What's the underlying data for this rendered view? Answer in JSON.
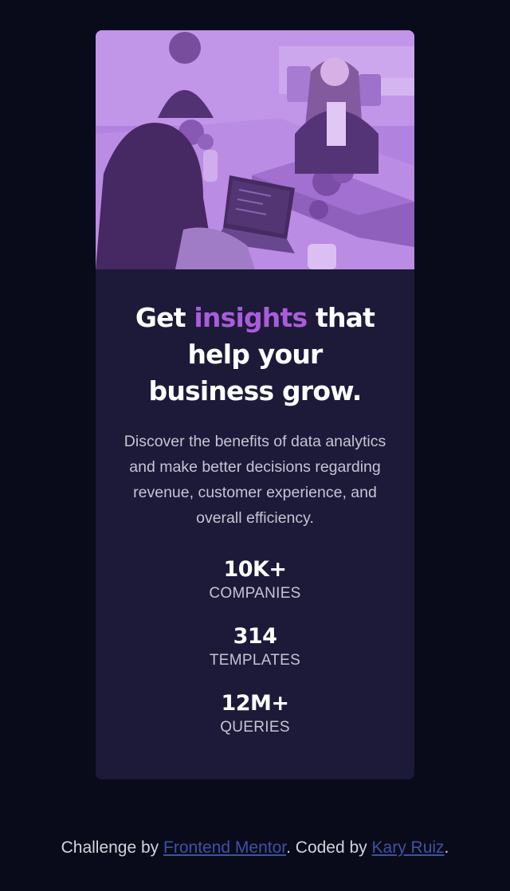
{
  "card": {
    "image": {
      "subject": "team of people working at laptops in office",
      "tint_color": "#aa5cdb"
    },
    "headline": {
      "before": "Get ",
      "accent": "insights",
      "after": " that help your business grow."
    },
    "description": "Discover the benefits of data analytics and make better decisions regarding revenue, customer experience, and overall efficiency.",
    "stats": [
      {
        "value": "10K+",
        "label": "COMPANIES"
      },
      {
        "value": "314",
        "label": "TEMPLATES"
      },
      {
        "value": "12M+",
        "label": "QUERIES"
      }
    ]
  },
  "attribution": {
    "prefix": "Challenge by ",
    "link1": "Frontend Mentor",
    "middle": ". Coded by ",
    "link2": "Kary Ruiz",
    "suffix": "."
  },
  "colors": {
    "background": "#090b1a",
    "card": "#1c1a38",
    "accent": "#aa5cdb",
    "text_muted": "#c6c4d4",
    "link": "#3e52a3"
  }
}
